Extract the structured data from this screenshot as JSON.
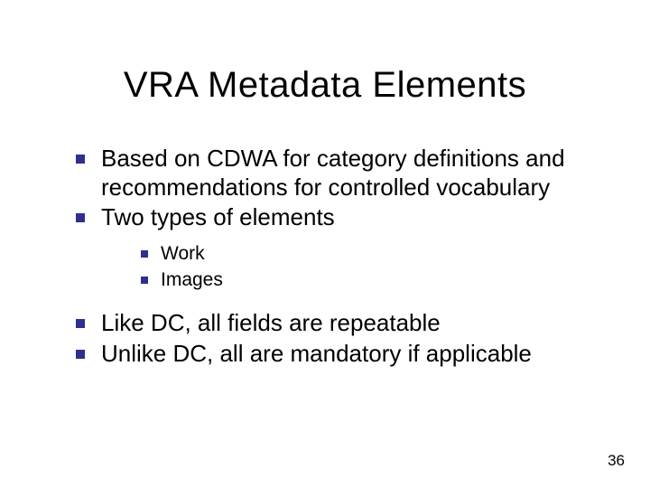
{
  "slide": {
    "title": "VRA Metadata Elements",
    "bullets": {
      "b1": "Based on CDWA for category definitions and recommendations for controlled vocabulary",
      "b2": "Two types of elements",
      "b2_children": {
        "c1": "Work",
        "c2": "Images"
      },
      "b3": "Like DC, all fields are repeatable",
      "b4": "Unlike DC, all are mandatory if applicable"
    },
    "page_number": "36"
  }
}
